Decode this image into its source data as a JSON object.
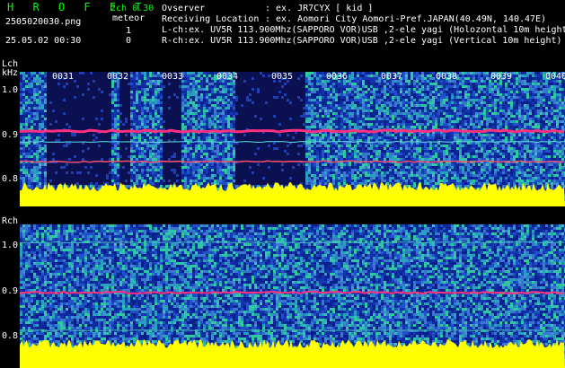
{
  "header": {
    "logo": "H R O F F T",
    "filename": "2505020030.png",
    "datetime": "25.05.02 00:30",
    "version": "2ch 0.30",
    "mode": "meteor",
    "count_l": "1",
    "count_r": "0",
    "observer_label": "Ovserver",
    "observer_value": ": ex. JR7CYX [ kid ]",
    "location_label": "Receiving Location",
    "location_value": ": ex. Aomori City Aomori-Pref.JAPAN(40.49N, 140.47E)",
    "lch_info": "L-ch:ex. UV5R 113.900Mhz(SAPPORO VOR)USB ,2-ele yagi (Holozontal 10m height",
    "rch_info": "R-ch:ex. UV5R 113.900Mhz(SAPPORO VOR)USB ,2-ele yagi (Vertical 10m height)"
  },
  "lch": {
    "label": "Lch",
    "unit": "kHz",
    "yticks": [
      "1.0",
      "0.9",
      "0.8"
    ]
  },
  "rch": {
    "label": "Rch",
    "yticks": [
      "1.0",
      "0.9",
      "0.8"
    ]
  },
  "minutes": [
    "0031",
    "0032",
    "0033",
    "0034",
    "0035",
    "0036",
    "0037",
    "0038",
    "0039",
    "0040"
  ],
  "colors": {
    "bg_noise": "#1a3aa0",
    "signal": "#ff3080",
    "floor": "#ffff00",
    "text_green": "#00ff00"
  }
}
